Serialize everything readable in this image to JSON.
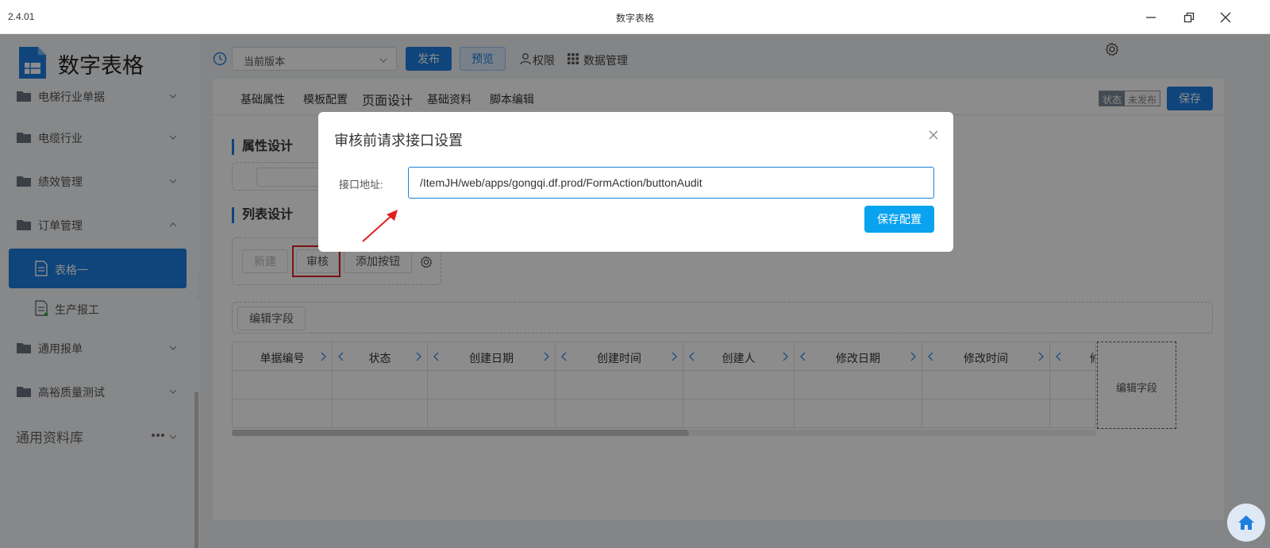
{
  "window": {
    "version": "2.4.01",
    "title": "数字表格"
  },
  "sidebar": {
    "app_name": "数字表格",
    "items": [
      {
        "label": "电梯行业单据"
      },
      {
        "label": "电缆行业"
      },
      {
        "label": "绩效管理"
      },
      {
        "label": "订单管理"
      }
    ],
    "sub_items": [
      {
        "label": "表格一",
        "active": true
      },
      {
        "label": "生产报工",
        "active": false
      }
    ],
    "items2": [
      {
        "label": "通用报单"
      },
      {
        "label": "高裕质量测试"
      }
    ],
    "library_label": "通用资料库",
    "accent": "#1c7fe0"
  },
  "toolbar": {
    "version_select": "当前版本",
    "publish": "发布",
    "preview": "预览",
    "permission": "权限",
    "data_manage": "数据管理"
  },
  "tabs": [
    "基础属性",
    "模板配置",
    "页面设计",
    "基础资料",
    "脚本编辑"
  ],
  "status": {
    "label": "状态",
    "value": "未发布"
  },
  "save": "保存",
  "sections": {
    "property_design": "属性设计",
    "list_design": "列表设计"
  },
  "list_buttons": {
    "new": "新建",
    "audit": "审核",
    "add_button": "添加按钮"
  },
  "edit_field": "编辑字段",
  "table": {
    "columns": [
      "单据编号",
      "状态",
      "创建日期",
      "创建时间",
      "创建人",
      "修改日期",
      "修改时间",
      "修"
    ]
  },
  "modal": {
    "title": "审核前请求接口设置",
    "field_label": "接口地址:",
    "field_value": "/ItemJH/web/apps/gongqi.df.prod/FormAction/buttonAudit",
    "save_label": "保存配置"
  }
}
